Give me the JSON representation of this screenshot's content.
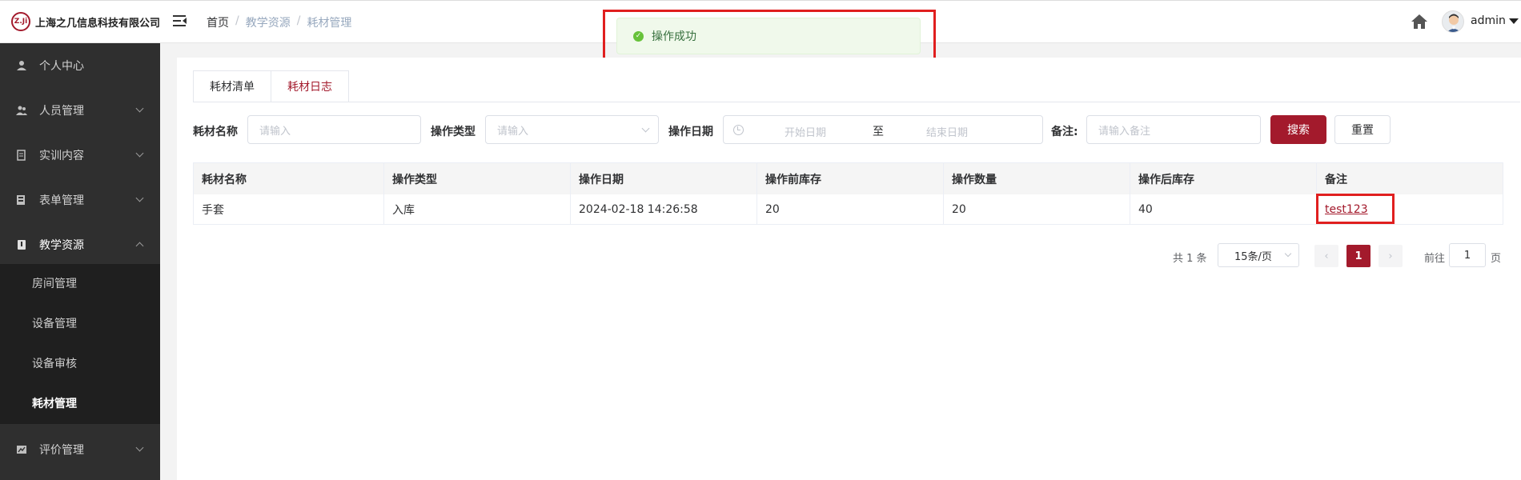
{
  "header": {
    "company_logo_text": "Z.Ji",
    "company_name": "上海之几信息科技有限公司",
    "breadcrumb": [
      "首页",
      "教学资源",
      "耗材管理"
    ],
    "breadcrumb_separator": "/",
    "user_name": "admin"
  },
  "toast": {
    "message": "操作成功",
    "type": "success"
  },
  "sidebar": {
    "items": [
      {
        "label": "个人中心",
        "icon": "user-icon",
        "expandable": false
      },
      {
        "label": "人员管理",
        "icon": "users-icon",
        "expandable": true
      },
      {
        "label": "实训内容",
        "icon": "doc-icon",
        "expandable": true
      },
      {
        "label": "表单管理",
        "icon": "form-icon",
        "expandable": true
      },
      {
        "label": "教学资源",
        "icon": "book-icon",
        "expandable": true,
        "open": true
      },
      {
        "label": "评价管理",
        "icon": "chart-icon",
        "expandable": true
      }
    ],
    "subitems": [
      {
        "label": "房间管理",
        "active": false
      },
      {
        "label": "设备管理",
        "active": false
      },
      {
        "label": "设备审核",
        "active": false
      },
      {
        "label": "耗材管理",
        "active": true
      }
    ]
  },
  "tabs": [
    {
      "label": "耗材清单",
      "active": false
    },
    {
      "label": "耗材日志",
      "active": true
    }
  ],
  "filters": {
    "name_label": "耗材名称",
    "name_placeholder": "请输入",
    "type_label": "操作类型",
    "type_placeholder": "请输入",
    "date_label": "操作日期",
    "date_start_placeholder": "开始日期",
    "date_to": "至",
    "date_end_placeholder": "结束日期",
    "note_label": "备注:",
    "note_placeholder": "请输入备注",
    "search_button": "搜索",
    "reset_button": "重置"
  },
  "table": {
    "columns": [
      "耗材名称",
      "操作类型",
      "操作日期",
      "操作前库存",
      "操作数量",
      "操作后库存",
      "备注"
    ],
    "rows": [
      [
        "手套",
        "入库",
        "2024-02-18 14:26:58",
        "20",
        "20",
        "40",
        "test123"
      ]
    ]
  },
  "pagination": {
    "total_text": "共 1 条",
    "page_size": "15条/页",
    "prev": "‹",
    "current_page": "1",
    "next": "›",
    "goto_label": "前往",
    "goto_value": "1",
    "page_suffix": "页"
  },
  "colors": {
    "accent": "#a31a2c",
    "sidebar_bg": "#2f2f2f",
    "submenu_bg": "#1f1f1f",
    "toast_bg": "#f0f9eb",
    "highlight_box": "#e01f1f"
  }
}
